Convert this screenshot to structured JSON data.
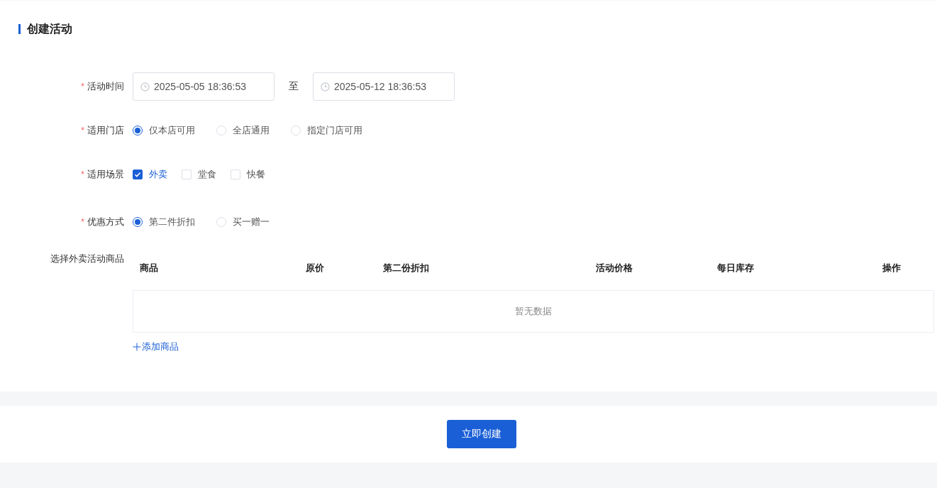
{
  "section_title": "创建活动",
  "form": {
    "fields": [
      {
        "kind": "date_range",
        "label": "活动时间",
        "required_mark": "*",
        "start": "2025-05-05 18:36:53",
        "separator": "至",
        "end": "2025-05-12 18:36:53"
      },
      {
        "kind": "radio",
        "label": "适用门店",
        "required_mark": "*",
        "options": [
          {
            "label": "仅本店可用",
            "selected": true
          },
          {
            "label": "全店通用",
            "selected": false
          },
          {
            "label": "指定门店可用",
            "selected": false
          }
        ]
      },
      {
        "kind": "checkbox",
        "label": "适用场景",
        "required_mark": "*",
        "options": [
          {
            "label": "外卖",
            "checked": true
          },
          {
            "label": "堂食",
            "checked": false
          },
          {
            "label": "快餐",
            "checked": false
          }
        ]
      },
      {
        "kind": "radio",
        "label": "优惠方式",
        "required_mark": "*",
        "options": [
          {
            "label": "第二件折扣",
            "selected": true
          },
          {
            "label": "买一赠一",
            "selected": false
          }
        ]
      },
      {
        "kind": "table",
        "label": "选择外卖活动商品",
        "columns": [
          "商品",
          "原价",
          "第二份折扣",
          "活动价格",
          "每日库存",
          "操作"
        ],
        "empty_text": "暂无数据",
        "add_link": "添加商品"
      }
    ]
  },
  "submit_button": "立即创建"
}
